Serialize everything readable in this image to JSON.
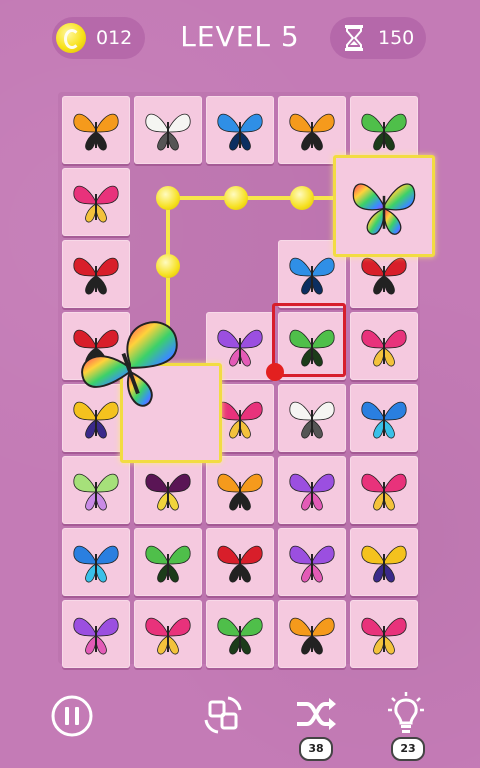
{
  "header": {
    "coins": "012",
    "level_label": "LEVEL 5",
    "time_left": "150"
  },
  "toolbar": {
    "shuffle_count": "38",
    "hint_count": "23"
  },
  "board": {
    "rows": 8,
    "cols": 5,
    "tiles": [
      [
        "orange-monarch",
        "white-butterfly",
        "blue-morpho",
        "orange-monarch",
        "green-swallowtail"
      ],
      [
        "pink-butterfly",
        "",
        "",
        "",
        ""
      ],
      [
        "red-butterfly",
        "",
        "",
        "blue-morpho",
        "red-butterfly"
      ],
      [
        "red-butterfly",
        "",
        "purple-butterfly",
        "green-swallowtail",
        "pink-butterfly"
      ],
      [
        "yellow-butterfly",
        "",
        "pink-butterfly",
        "white-butterfly",
        "blue-butterfly"
      ],
      [
        "lime-butterfly",
        "purple-dark",
        "orange-monarch",
        "purple-butterfly",
        "pink-butterfly"
      ],
      [
        "blue-butterfly",
        "green-swallowtail",
        "red-butterfly",
        "purple-butterfly",
        "yellow-butterfly"
      ],
      [
        "purple-butterfly",
        "pink-butterfly",
        "green-swallowtail",
        "orange-monarch",
        "pink-butterfly"
      ]
    ],
    "selected_rainbow_top": "rainbow-butterfly",
    "selected_rainbow_dragged": "rainbow-butterfly"
  },
  "colors": {
    "background": "#c47bb6",
    "tile": "#f5c9df",
    "highlight": "#f2dc42",
    "selection": "#d71e2c"
  }
}
